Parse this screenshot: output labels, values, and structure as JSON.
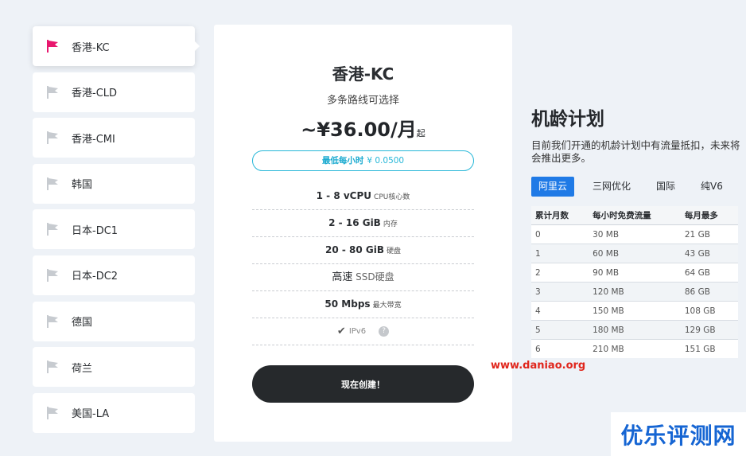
{
  "sidebar": {
    "items": [
      {
        "label": "香港-KC",
        "active": true
      },
      {
        "label": "香港-CLD",
        "active": false
      },
      {
        "label": "香港-CMI",
        "active": false
      },
      {
        "label": "韩国",
        "active": false
      },
      {
        "label": "日本-DC1",
        "active": false
      },
      {
        "label": "日本-DC2",
        "active": false
      },
      {
        "label": "德国",
        "active": false
      },
      {
        "label": "荷兰",
        "active": false
      },
      {
        "label": "美国-LA",
        "active": false
      }
    ],
    "active_flag_color": "#e8176e",
    "inactive_flag_color": "#c7cbd0"
  },
  "plan": {
    "title": "香港-KC",
    "subtitle": "多条路线可选择",
    "price_prefix": "~¥36.00/月",
    "price_suffix": "起",
    "hourly_label": "最低每小时",
    "hourly_value": "¥ 0.0500",
    "specs": [
      {
        "main": "1 - 8 vCPU",
        "unit": "CPU核心数"
      },
      {
        "main": "2 - 16 GiB",
        "unit": "内存"
      },
      {
        "main": "20 - 80 GiB",
        "unit": "硬盘"
      },
      {
        "main": "高速",
        "unit": "SSD硬盘"
      },
      {
        "main": "50 Mbps",
        "unit": "最大带宽"
      }
    ],
    "ipv6_label": "IPv6",
    "help_glyph": "?",
    "check_glyph": "✔",
    "create_button": "现在创建！"
  },
  "aging_plan": {
    "title": "机龄计划",
    "description": "目前我们开通的机龄计划中有流量抵扣，未来将会推出更多。",
    "tabs": [
      {
        "label": "阿里云",
        "active": true
      },
      {
        "label": "三网优化",
        "active": false
      },
      {
        "label": "国际",
        "active": false
      },
      {
        "label": "纯V6",
        "active": false
      }
    ],
    "table": {
      "headers": [
        "累计月数",
        "每小时免费流量",
        "每月最多"
      ],
      "rows": [
        [
          "0",
          "30 MB",
          "21 GB"
        ],
        [
          "1",
          "60 MB",
          "43 GB"
        ],
        [
          "2",
          "90 MB",
          "64 GB"
        ],
        [
          "3",
          "120 MB",
          "86 GB"
        ],
        [
          "4",
          "150 MB",
          "108 GB"
        ],
        [
          "5",
          "180 MB",
          "129 GB"
        ],
        [
          "6",
          "210 MB",
          "151 GB"
        ]
      ]
    }
  },
  "watermark": {
    "url": "www.daniao.org",
    "site": "优乐评测网"
  },
  "colors": {
    "accent_blue": "#1f7ae6",
    "hourly_border": "#27b7d8",
    "button_dark": "#26292c",
    "watermark_red": "#e0251b"
  }
}
